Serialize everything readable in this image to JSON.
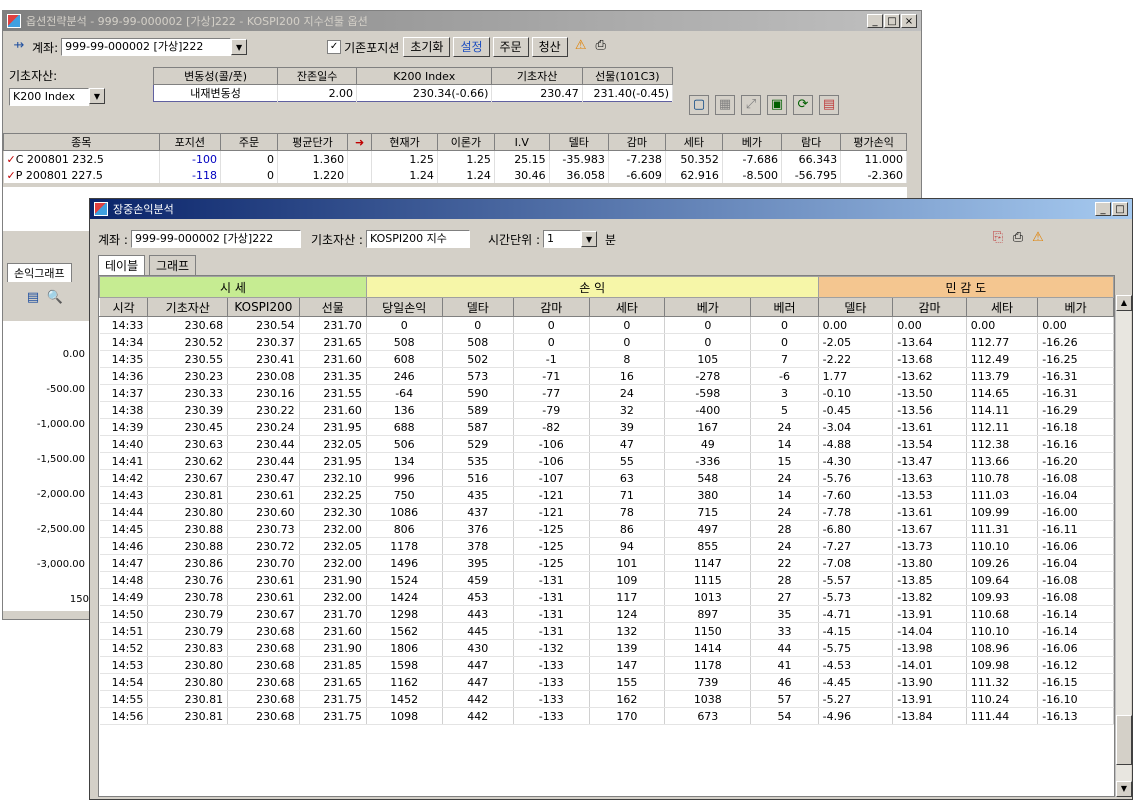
{
  "back_window": {
    "title": "옵션전략분석 - 999-99-000002 [가상]222 - KOSPI200 지수선물 옵션",
    "account_label": "계좌:",
    "account_value": "999-99-000002 [가상]222",
    "checkbox_label": "기존포지션",
    "buttons": [
      "초기화",
      "설정",
      "주문",
      "청산"
    ],
    "underlying_label": "기초자산:",
    "underlying_value": "K200 Index",
    "info_headers": [
      "변동성(콜/풋)",
      "잔존일수",
      "K200 Index",
      "기초자산",
      "선물(101C3)"
    ],
    "info_values": [
      "내재변동성",
      "2.00",
      "230.34(-0.66)",
      "230.47",
      "231.40(-0.45)"
    ],
    "pos_headers": [
      "종목",
      "포지션",
      "주문",
      "평균단가",
      "",
      "현재가",
      "이론가",
      "I.V",
      "델타",
      "감마",
      "세타",
      "베가",
      "람다",
      "평가손익"
    ],
    "pos_rows": [
      [
        "C 200801 232.5",
        "-100",
        "0",
        "1.360",
        "",
        "1.25",
        "1.25",
        "25.15",
        "-35.983",
        "-7.238",
        "50.352",
        "-7.686",
        "66.343",
        "11.000"
      ],
      [
        "P 200801 227.5",
        "-118",
        "0",
        "1.220",
        "",
        "1.24",
        "1.24",
        "30.46",
        "36.058",
        "-6.609",
        "62.916",
        "-8.500",
        "-56.795",
        "-2.360"
      ]
    ],
    "left_tab": "손익그래프",
    "y_axis": [
      "0.00",
      "-500.00",
      "-1,000.00",
      "-1,500.00",
      "-2,000.00",
      "-2,500.00",
      "-3,000.00"
    ],
    "x_partial": "150"
  },
  "front_window": {
    "title": "장중손익분석",
    "account_label": "계좌 :",
    "account_value": "999-99-000002 [가상]222",
    "underlying_label": "기초자산 :",
    "underlying_value": "KOSPI200 지수",
    "time_label": "시간단위 :",
    "time_value": "1",
    "time_unit": "분",
    "tabs": [
      "테이블",
      "그래프"
    ],
    "groups": [
      "시 세",
      "손 익",
      "민 감 도"
    ],
    "columns": [
      "시각",
      "기초자산",
      "KOSPI200",
      "선물",
      "당일손익",
      "델타",
      "감마",
      "세타",
      "베가",
      "베러",
      "델타",
      "감마",
      "세타",
      "베가"
    ],
    "rows": [
      [
        "14:33",
        "230.68",
        "230.54",
        "231.70",
        "0",
        "0",
        "0",
        "0",
        "0",
        "0",
        "0.00",
        "0.00",
        "0.00",
        "0.00"
      ],
      [
        "14:34",
        "230.52",
        "230.37",
        "231.65",
        "508",
        "508",
        "0",
        "0",
        "0",
        "0",
        "-2.05",
        "-13.64",
        "112.77",
        "-16.26"
      ],
      [
        "14:35",
        "230.55",
        "230.41",
        "231.60",
        "608",
        "502",
        "-1",
        "8",
        "105",
        "7",
        "-2.22",
        "-13.68",
        "112.49",
        "-16.25"
      ],
      [
        "14:36",
        "230.23",
        "230.08",
        "231.35",
        "246",
        "573",
        "-71",
        "16",
        "-278",
        "-6",
        "1.77",
        "-13.62",
        "113.79",
        "-16.31"
      ],
      [
        "14:37",
        "230.33",
        "230.16",
        "231.55",
        "-64",
        "590",
        "-77",
        "24",
        "-598",
        "3",
        "-0.10",
        "-13.50",
        "114.65",
        "-16.31"
      ],
      [
        "14:38",
        "230.39",
        "230.22",
        "231.60",
        "136",
        "589",
        "-79",
        "32",
        "-400",
        "5",
        "-0.45",
        "-13.56",
        "114.11",
        "-16.29"
      ],
      [
        "14:39",
        "230.45",
        "230.24",
        "231.95",
        "688",
        "587",
        "-82",
        "39",
        "167",
        "24",
        "-3.04",
        "-13.61",
        "112.11",
        "-16.18"
      ],
      [
        "14:40",
        "230.63",
        "230.44",
        "232.05",
        "506",
        "529",
        "-106",
        "47",
        "49",
        "14",
        "-4.88",
        "-13.54",
        "112.38",
        "-16.16"
      ],
      [
        "14:41",
        "230.62",
        "230.44",
        "231.95",
        "134",
        "535",
        "-106",
        "55",
        "-336",
        "15",
        "-4.30",
        "-13.47",
        "113.66",
        "-16.20"
      ],
      [
        "14:42",
        "230.67",
        "230.47",
        "232.10",
        "996",
        "516",
        "-107",
        "63",
        "548",
        "24",
        "-5.76",
        "-13.63",
        "110.78",
        "-16.08"
      ],
      [
        "14:43",
        "230.81",
        "230.61",
        "232.25",
        "750",
        "435",
        "-121",
        "71",
        "380",
        "14",
        "-7.60",
        "-13.53",
        "111.03",
        "-16.04"
      ],
      [
        "14:44",
        "230.80",
        "230.60",
        "232.30",
        "1086",
        "437",
        "-121",
        "78",
        "715",
        "24",
        "-7.78",
        "-13.61",
        "109.99",
        "-16.00"
      ],
      [
        "14:45",
        "230.88",
        "230.73",
        "232.00",
        "806",
        "376",
        "-125",
        "86",
        "497",
        "28",
        "-6.80",
        "-13.67",
        "111.31",
        "-16.11"
      ],
      [
        "14:46",
        "230.88",
        "230.72",
        "232.05",
        "1178",
        "378",
        "-125",
        "94",
        "855",
        "24",
        "-7.27",
        "-13.73",
        "110.10",
        "-16.06"
      ],
      [
        "14:47",
        "230.86",
        "230.70",
        "232.00",
        "1496",
        "395",
        "-125",
        "101",
        "1147",
        "22",
        "-7.08",
        "-13.80",
        "109.26",
        "-16.04"
      ],
      [
        "14:48",
        "230.76",
        "230.61",
        "231.90",
        "1524",
        "459",
        "-131",
        "109",
        "1115",
        "28",
        "-5.57",
        "-13.85",
        "109.64",
        "-16.08"
      ],
      [
        "14:49",
        "230.78",
        "230.61",
        "232.00",
        "1424",
        "453",
        "-131",
        "117",
        "1013",
        "27",
        "-5.73",
        "-13.82",
        "109.93",
        "-16.08"
      ],
      [
        "14:50",
        "230.79",
        "230.67",
        "231.70",
        "1298",
        "443",
        "-131",
        "124",
        "897",
        "35",
        "-4.71",
        "-13.91",
        "110.68",
        "-16.14"
      ],
      [
        "14:51",
        "230.79",
        "230.68",
        "231.60",
        "1562",
        "445",
        "-131",
        "132",
        "1150",
        "33",
        "-4.15",
        "-14.04",
        "110.10",
        "-16.14"
      ],
      [
        "14:52",
        "230.83",
        "230.68",
        "231.90",
        "1806",
        "430",
        "-132",
        "139",
        "1414",
        "44",
        "-5.75",
        "-13.98",
        "108.96",
        "-16.06"
      ],
      [
        "14:53",
        "230.80",
        "230.68",
        "231.85",
        "1598",
        "447",
        "-133",
        "147",
        "1178",
        "41",
        "-4.53",
        "-14.01",
        "109.98",
        "-16.12"
      ],
      [
        "14:54",
        "230.80",
        "230.68",
        "231.65",
        "1162",
        "447",
        "-133",
        "155",
        "739",
        "46",
        "-4.45",
        "-13.90",
        "111.32",
        "-16.15"
      ],
      [
        "14:55",
        "230.81",
        "230.68",
        "231.75",
        "1452",
        "442",
        "-133",
        "162",
        "1038",
        "57",
        "-5.27",
        "-13.91",
        "110.24",
        "-16.10"
      ],
      [
        "14:56",
        "230.81",
        "230.68",
        "231.75",
        "1098",
        "442",
        "-133",
        "170",
        "673",
        "54",
        "-4.96",
        "-13.84",
        "111.44",
        "-16.13"
      ]
    ]
  },
  "colors": {
    "group_sise": "#c6ec92",
    "group_sonik": "#f6f6a8",
    "group_mingam": "#f4c690",
    "value_blue": "#0000c0",
    "value_red": "#c00000"
  }
}
